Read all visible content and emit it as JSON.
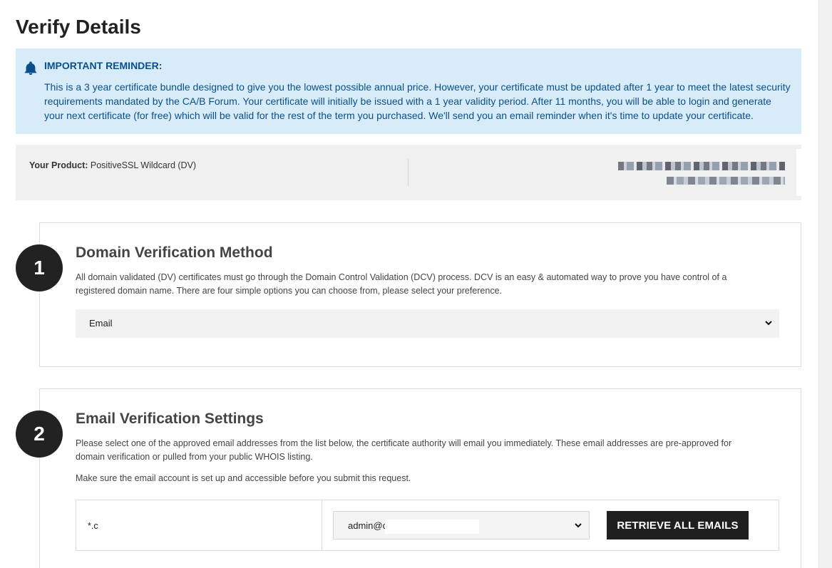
{
  "page": {
    "title": "Verify Details"
  },
  "reminder": {
    "title": "IMPORTANT REMINDER:",
    "body": "This is a 3 year certificate bundle designed to give you the lowest possible annual price. However, your certificate must be updated after 1 year to meet the latest security requirements mandated by the CA/B Forum. Your certificate will initially be issued with a 1 year validity period. After 11 months, you will be able to login and generate your next certificate (for free) which will be valid for the rest of the term you purchased. We'll send you an email reminder when it's time to update your certificate.",
    "icon": "bell-icon"
  },
  "product": {
    "label": "Your Product:",
    "value": "PositiveSSL Wildcard (DV)"
  },
  "step1": {
    "number": "1",
    "title": "Domain Verification Method",
    "description": "All domain validated (DV) certificates must go through the Domain Control Validation (DCV) process. DCV is an easy & automated way to prove you have control of a registered domain name. There are four simple options you can choose from, please select your preference.",
    "method_selected": "Email"
  },
  "step2": {
    "number": "2",
    "title": "Email Verification Settings",
    "description": "Please select one of the approved email addresses from the list below, the certificate authority will email you immediately. These email addresses are pre-approved for domain verification or pulled from your public WHOIS listing.",
    "note": "Make sure the email account is set up and accessible before you submit this request.",
    "domain": "*.c",
    "email_selected": "admin@c",
    "retrieve_label": "RETRIEVE ALL EMAILS"
  },
  "colors": {
    "reminder_bg": "#d7ecf8",
    "reminder_text": "#0b4f8a",
    "button_bg": "#1f1f1f",
    "step_circle": "#222222"
  }
}
